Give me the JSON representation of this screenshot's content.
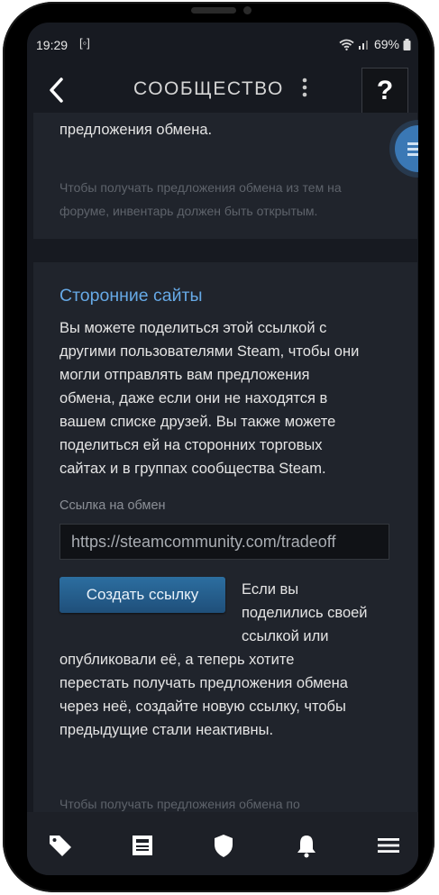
{
  "status": {
    "time": "19:29",
    "battery": "69%"
  },
  "header": {
    "title": "СООБЩЕСТВО",
    "help": "?"
  },
  "card1": {
    "text": "предложения обмена.",
    "hint_line1": "Чтобы получать предложения обмена из тем на",
    "hint_line2": "форуме, инвентарь должен быть открытым."
  },
  "card2": {
    "title": "Сторонние сайты",
    "desc_lines": [
      "Вы можете поделиться этой ссылкой с",
      "другими пользователями Steam, чтобы они",
      "могли отправлять вам предложения",
      "обмена, даже если они не находятся в",
      "вашем списке друзей. Вы также можете",
      "поделиться ей на сторонних торговых",
      "сайтах и в группах сообщества Steam."
    ],
    "link_label": "Ссылка на обмен",
    "link_value": "https://steamcommunity.com/tradeoff",
    "create_button": "Создать ссылку",
    "side_lines": [
      "Если вы",
      "поделились своей",
      "ссылкой или"
    ],
    "after_lines": [
      "опубликовали её, а теперь хотите",
      "перестать получать предложения обмена",
      "через неё, создайте новую ссылку, чтобы",
      "предыдущие стали неактивны."
    ],
    "bottom_hint": "Чтобы получать предложения обмена по"
  },
  "nav": {
    "icons": [
      "tag-icon",
      "news-icon",
      "shield-icon",
      "bell-icon",
      "menu-icon"
    ]
  },
  "colors": {
    "accent": "#66a9e6",
    "button": "#2c6ea0",
    "background": "#171a21"
  }
}
